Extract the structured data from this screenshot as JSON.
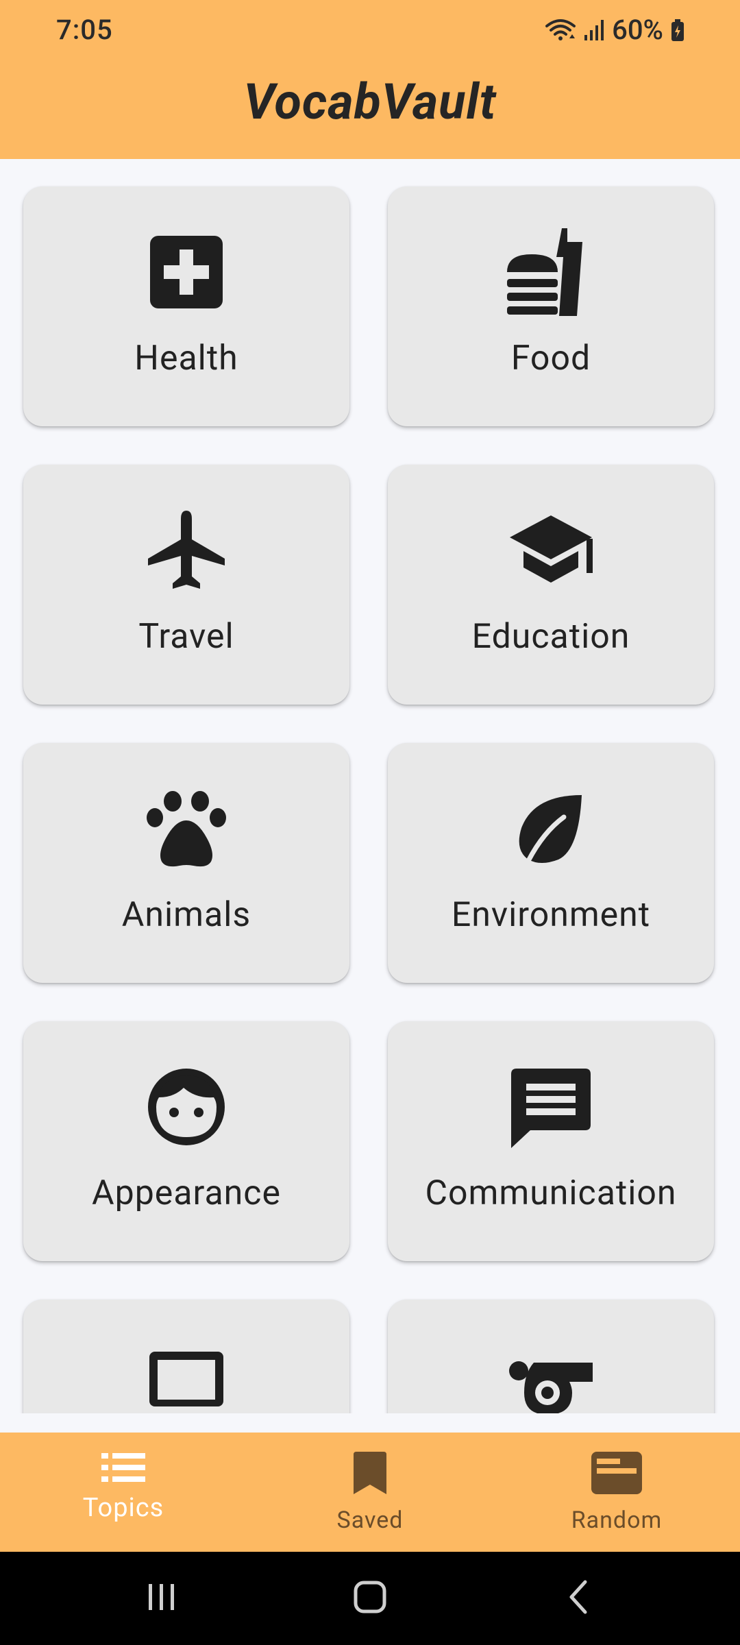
{
  "status_bar": {
    "time": "7:05",
    "battery": "60%"
  },
  "app": {
    "title": "VocabVault"
  },
  "topics": [
    {
      "label": "Health",
      "icon": "medical-cross-icon"
    },
    {
      "label": "Food",
      "icon": "fastfood-icon"
    },
    {
      "label": "Travel",
      "icon": "airplane-icon"
    },
    {
      "label": "Education",
      "icon": "graduation-cap-icon"
    },
    {
      "label": "Animals",
      "icon": "paw-icon"
    },
    {
      "label": "Environment",
      "icon": "leaf-icon"
    },
    {
      "label": "Appearance",
      "icon": "face-icon"
    },
    {
      "label": "Communication",
      "icon": "chat-message-icon"
    },
    {
      "label": "",
      "icon": "laptop-icon"
    },
    {
      "label": "",
      "icon": "whistle-icon"
    }
  ],
  "bottom_nav": {
    "items": [
      {
        "label": "Topics",
        "icon": "list-icon",
        "active": true
      },
      {
        "label": "Saved",
        "icon": "bookmark-icon",
        "active": false
      },
      {
        "label": "Random",
        "icon": "random-card-icon",
        "active": false
      }
    ]
  },
  "colors": {
    "accent": "#fdb962",
    "card": "#e8e8e8",
    "background": "#f6f7fb",
    "active_nav_text": "#ffffff",
    "inactive_nav_text": "#6b4d2a"
  }
}
